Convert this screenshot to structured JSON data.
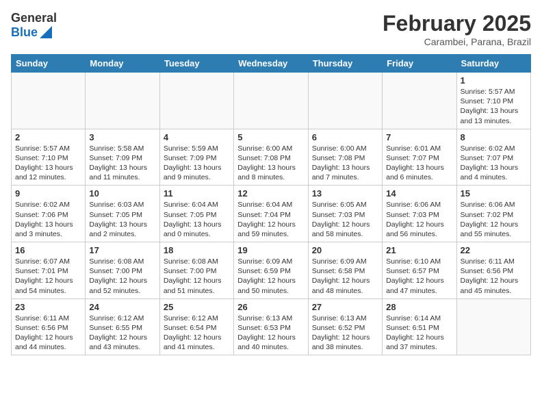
{
  "logo": {
    "line1": "General",
    "line2": "Blue"
  },
  "title": "February 2025",
  "location": "Carambei, Parana, Brazil",
  "days_of_week": [
    "Sunday",
    "Monday",
    "Tuesday",
    "Wednesday",
    "Thursday",
    "Friday",
    "Saturday"
  ],
  "weeks": [
    [
      {
        "day": "",
        "info": ""
      },
      {
        "day": "",
        "info": ""
      },
      {
        "day": "",
        "info": ""
      },
      {
        "day": "",
        "info": ""
      },
      {
        "day": "",
        "info": ""
      },
      {
        "day": "",
        "info": ""
      },
      {
        "day": "1",
        "info": "Sunrise: 5:57 AM\nSunset: 7:10 PM\nDaylight: 13 hours and 13 minutes."
      }
    ],
    [
      {
        "day": "2",
        "info": "Sunrise: 5:57 AM\nSunset: 7:10 PM\nDaylight: 13 hours and 12 minutes."
      },
      {
        "day": "3",
        "info": "Sunrise: 5:58 AM\nSunset: 7:09 PM\nDaylight: 13 hours and 11 minutes."
      },
      {
        "day": "4",
        "info": "Sunrise: 5:59 AM\nSunset: 7:09 PM\nDaylight: 13 hours and 9 minutes."
      },
      {
        "day": "5",
        "info": "Sunrise: 6:00 AM\nSunset: 7:08 PM\nDaylight: 13 hours and 8 minutes."
      },
      {
        "day": "6",
        "info": "Sunrise: 6:00 AM\nSunset: 7:08 PM\nDaylight: 13 hours and 7 minutes."
      },
      {
        "day": "7",
        "info": "Sunrise: 6:01 AM\nSunset: 7:07 PM\nDaylight: 13 hours and 6 minutes."
      },
      {
        "day": "8",
        "info": "Sunrise: 6:02 AM\nSunset: 7:07 PM\nDaylight: 13 hours and 4 minutes."
      }
    ],
    [
      {
        "day": "9",
        "info": "Sunrise: 6:02 AM\nSunset: 7:06 PM\nDaylight: 13 hours and 3 minutes."
      },
      {
        "day": "10",
        "info": "Sunrise: 6:03 AM\nSunset: 7:05 PM\nDaylight: 13 hours and 2 minutes."
      },
      {
        "day": "11",
        "info": "Sunrise: 6:04 AM\nSunset: 7:05 PM\nDaylight: 13 hours and 0 minutes."
      },
      {
        "day": "12",
        "info": "Sunrise: 6:04 AM\nSunset: 7:04 PM\nDaylight: 12 hours and 59 minutes."
      },
      {
        "day": "13",
        "info": "Sunrise: 6:05 AM\nSunset: 7:03 PM\nDaylight: 12 hours and 58 minutes."
      },
      {
        "day": "14",
        "info": "Sunrise: 6:06 AM\nSunset: 7:03 PM\nDaylight: 12 hours and 56 minutes."
      },
      {
        "day": "15",
        "info": "Sunrise: 6:06 AM\nSunset: 7:02 PM\nDaylight: 12 hours and 55 minutes."
      }
    ],
    [
      {
        "day": "16",
        "info": "Sunrise: 6:07 AM\nSunset: 7:01 PM\nDaylight: 12 hours and 54 minutes."
      },
      {
        "day": "17",
        "info": "Sunrise: 6:08 AM\nSunset: 7:00 PM\nDaylight: 12 hours and 52 minutes."
      },
      {
        "day": "18",
        "info": "Sunrise: 6:08 AM\nSunset: 7:00 PM\nDaylight: 12 hours and 51 minutes."
      },
      {
        "day": "19",
        "info": "Sunrise: 6:09 AM\nSunset: 6:59 PM\nDaylight: 12 hours and 50 minutes."
      },
      {
        "day": "20",
        "info": "Sunrise: 6:09 AM\nSunset: 6:58 PM\nDaylight: 12 hours and 48 minutes."
      },
      {
        "day": "21",
        "info": "Sunrise: 6:10 AM\nSunset: 6:57 PM\nDaylight: 12 hours and 47 minutes."
      },
      {
        "day": "22",
        "info": "Sunrise: 6:11 AM\nSunset: 6:56 PM\nDaylight: 12 hours and 45 minutes."
      }
    ],
    [
      {
        "day": "23",
        "info": "Sunrise: 6:11 AM\nSunset: 6:56 PM\nDaylight: 12 hours and 44 minutes."
      },
      {
        "day": "24",
        "info": "Sunrise: 6:12 AM\nSunset: 6:55 PM\nDaylight: 12 hours and 43 minutes."
      },
      {
        "day": "25",
        "info": "Sunrise: 6:12 AM\nSunset: 6:54 PM\nDaylight: 12 hours and 41 minutes."
      },
      {
        "day": "26",
        "info": "Sunrise: 6:13 AM\nSunset: 6:53 PM\nDaylight: 12 hours and 40 minutes."
      },
      {
        "day": "27",
        "info": "Sunrise: 6:13 AM\nSunset: 6:52 PM\nDaylight: 12 hours and 38 minutes."
      },
      {
        "day": "28",
        "info": "Sunrise: 6:14 AM\nSunset: 6:51 PM\nDaylight: 12 hours and 37 minutes."
      },
      {
        "day": "",
        "info": ""
      }
    ]
  ]
}
